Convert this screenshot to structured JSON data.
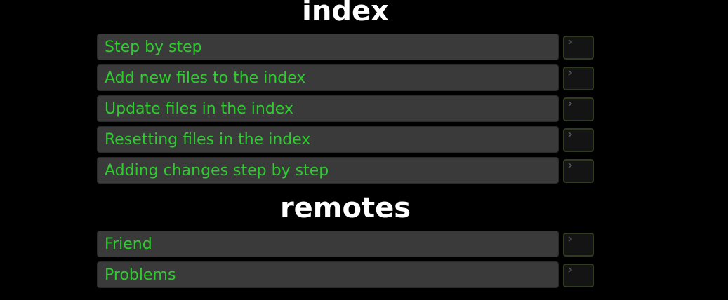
{
  "sections": [
    {
      "title": "index",
      "levels": [
        {
          "label": "Step by step"
        },
        {
          "label": "Add new files to the index"
        },
        {
          "label": "Update files in the index"
        },
        {
          "label": "Resetting files in the index"
        },
        {
          "label": "Adding changes step by step"
        }
      ]
    },
    {
      "title": "remotes",
      "levels": [
        {
          "label": "Friend"
        },
        {
          "label": "Problems"
        }
      ]
    }
  ],
  "icons": {
    "terminal": "terminal-prompt-icon"
  },
  "colors": {
    "background": "#000000",
    "title": "#ffffff",
    "level_text": "#2ecc2e",
    "level_background": "#3a3a3a",
    "terminal_background": "#141414",
    "terminal_border": "#2f3a1e"
  }
}
